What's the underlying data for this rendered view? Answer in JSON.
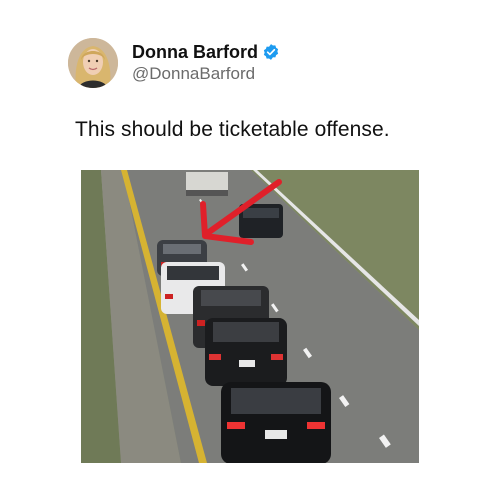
{
  "author": {
    "display_name": "Donna Barford",
    "handle": "@DonnaBarford",
    "verified": true,
    "verified_color": "#1d9bf0"
  },
  "tweet": {
    "text": "This should be ticketable offense."
  },
  "media": {
    "description_icon": "highway-photo",
    "annotation": "red-arrow",
    "annotation_color": "#e0202a"
  }
}
